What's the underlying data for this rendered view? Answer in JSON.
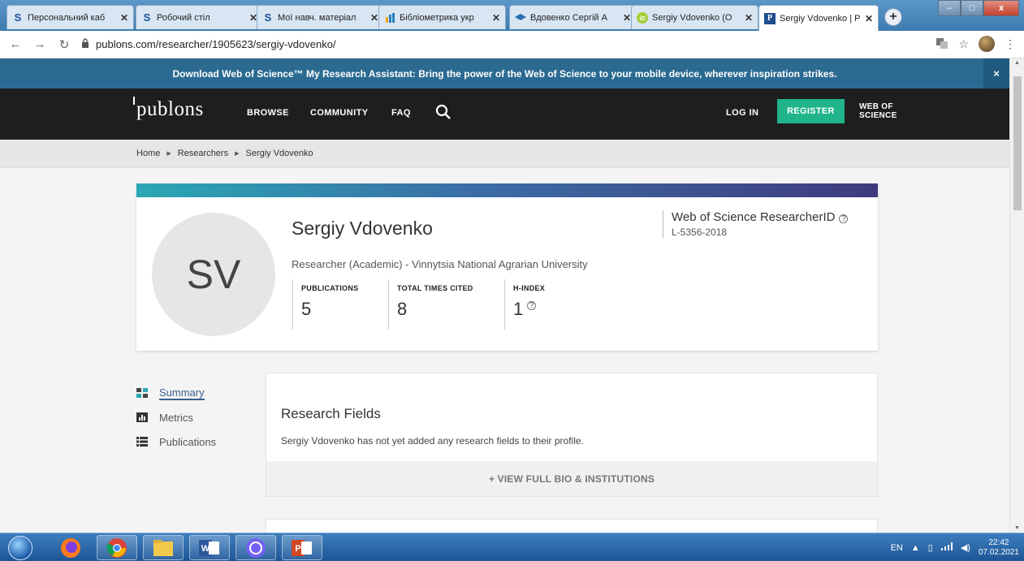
{
  "browser": {
    "tabs": [
      {
        "label": "Персональний каб",
        "favicon": "S",
        "favicon_color": "#1a4f9c"
      },
      {
        "label": "Робочий стіл",
        "favicon": "S",
        "favicon_color": "#1a4f9c"
      },
      {
        "label": "Мої навч. матеріал",
        "favicon": "S",
        "favicon_color": "#1a4f9c"
      },
      {
        "label": "Бібліометрика укр",
        "favicon": "bars",
        "favicon_color": "#2a7fc0"
      },
      {
        "label": "Вдовенко Сергій А",
        "favicon": "cap",
        "favicon_color": "#2a6fb0"
      },
      {
        "label": "Sergiy Vdovenko (O",
        "favicon": "iD",
        "favicon_color": "#a6ce39"
      },
      {
        "label": "Sergiy Vdovenko | P",
        "favicon": "P",
        "favicon_color": "#1e4e8c",
        "active": true
      }
    ],
    "new_tab": "+",
    "url": "publons.com/researcher/1905623/sergiy-vdovenko/",
    "window_controls": {
      "minimize": "–",
      "maximize": "□",
      "close": "x"
    }
  },
  "banner": {
    "text": "Download Web of Science™ My Research Assistant: Bring the power of the Web of Science to your mobile device, wherever inspiration strikes.",
    "close": "×"
  },
  "sitenav": {
    "logo": "publons",
    "links": [
      "BROWSE",
      "COMMUNITY",
      "FAQ"
    ],
    "login": "LOG IN",
    "register": "REGISTER",
    "wos_line1": "WEB OF",
    "wos_line2": "SCIENCE"
  },
  "breadcrumb": [
    "Home",
    "Researchers",
    "Sergiy Vdovenko"
  ],
  "profile": {
    "initials": "SV",
    "name": "Sergiy Vdovenko",
    "affiliation": "Researcher (Academic) - Vinnytsia National Agrarian University",
    "stats": [
      {
        "label": "PUBLICATIONS",
        "value": "5"
      },
      {
        "label": "TOTAL TIMES CITED",
        "value": "8"
      },
      {
        "label": "H-INDEX",
        "value": "1"
      }
    ],
    "researcher_id_title": "Web of Science ResearcherID",
    "researcher_id": "L-5356-2018"
  },
  "sidenav": [
    {
      "label": "Summary",
      "icon": "summary-icon"
    },
    {
      "label": "Metrics",
      "icon": "metrics-icon"
    },
    {
      "label": "Publications",
      "icon": "publications-icon"
    }
  ],
  "research_fields": {
    "title": "Research Fields",
    "text": "Sergiy Vdovenko has not yet added any research fields to their profile.",
    "button": "+ VIEW FULL BIO & INSTITUTIONS"
  },
  "taskbar": {
    "lang": "EN",
    "time": "22:42",
    "date": "07.02.2021"
  },
  "colors": {
    "banner": "#2a6a93",
    "nav": "#1e1e1e",
    "register": "#1fb48a",
    "accent": "#3a5f8f"
  }
}
